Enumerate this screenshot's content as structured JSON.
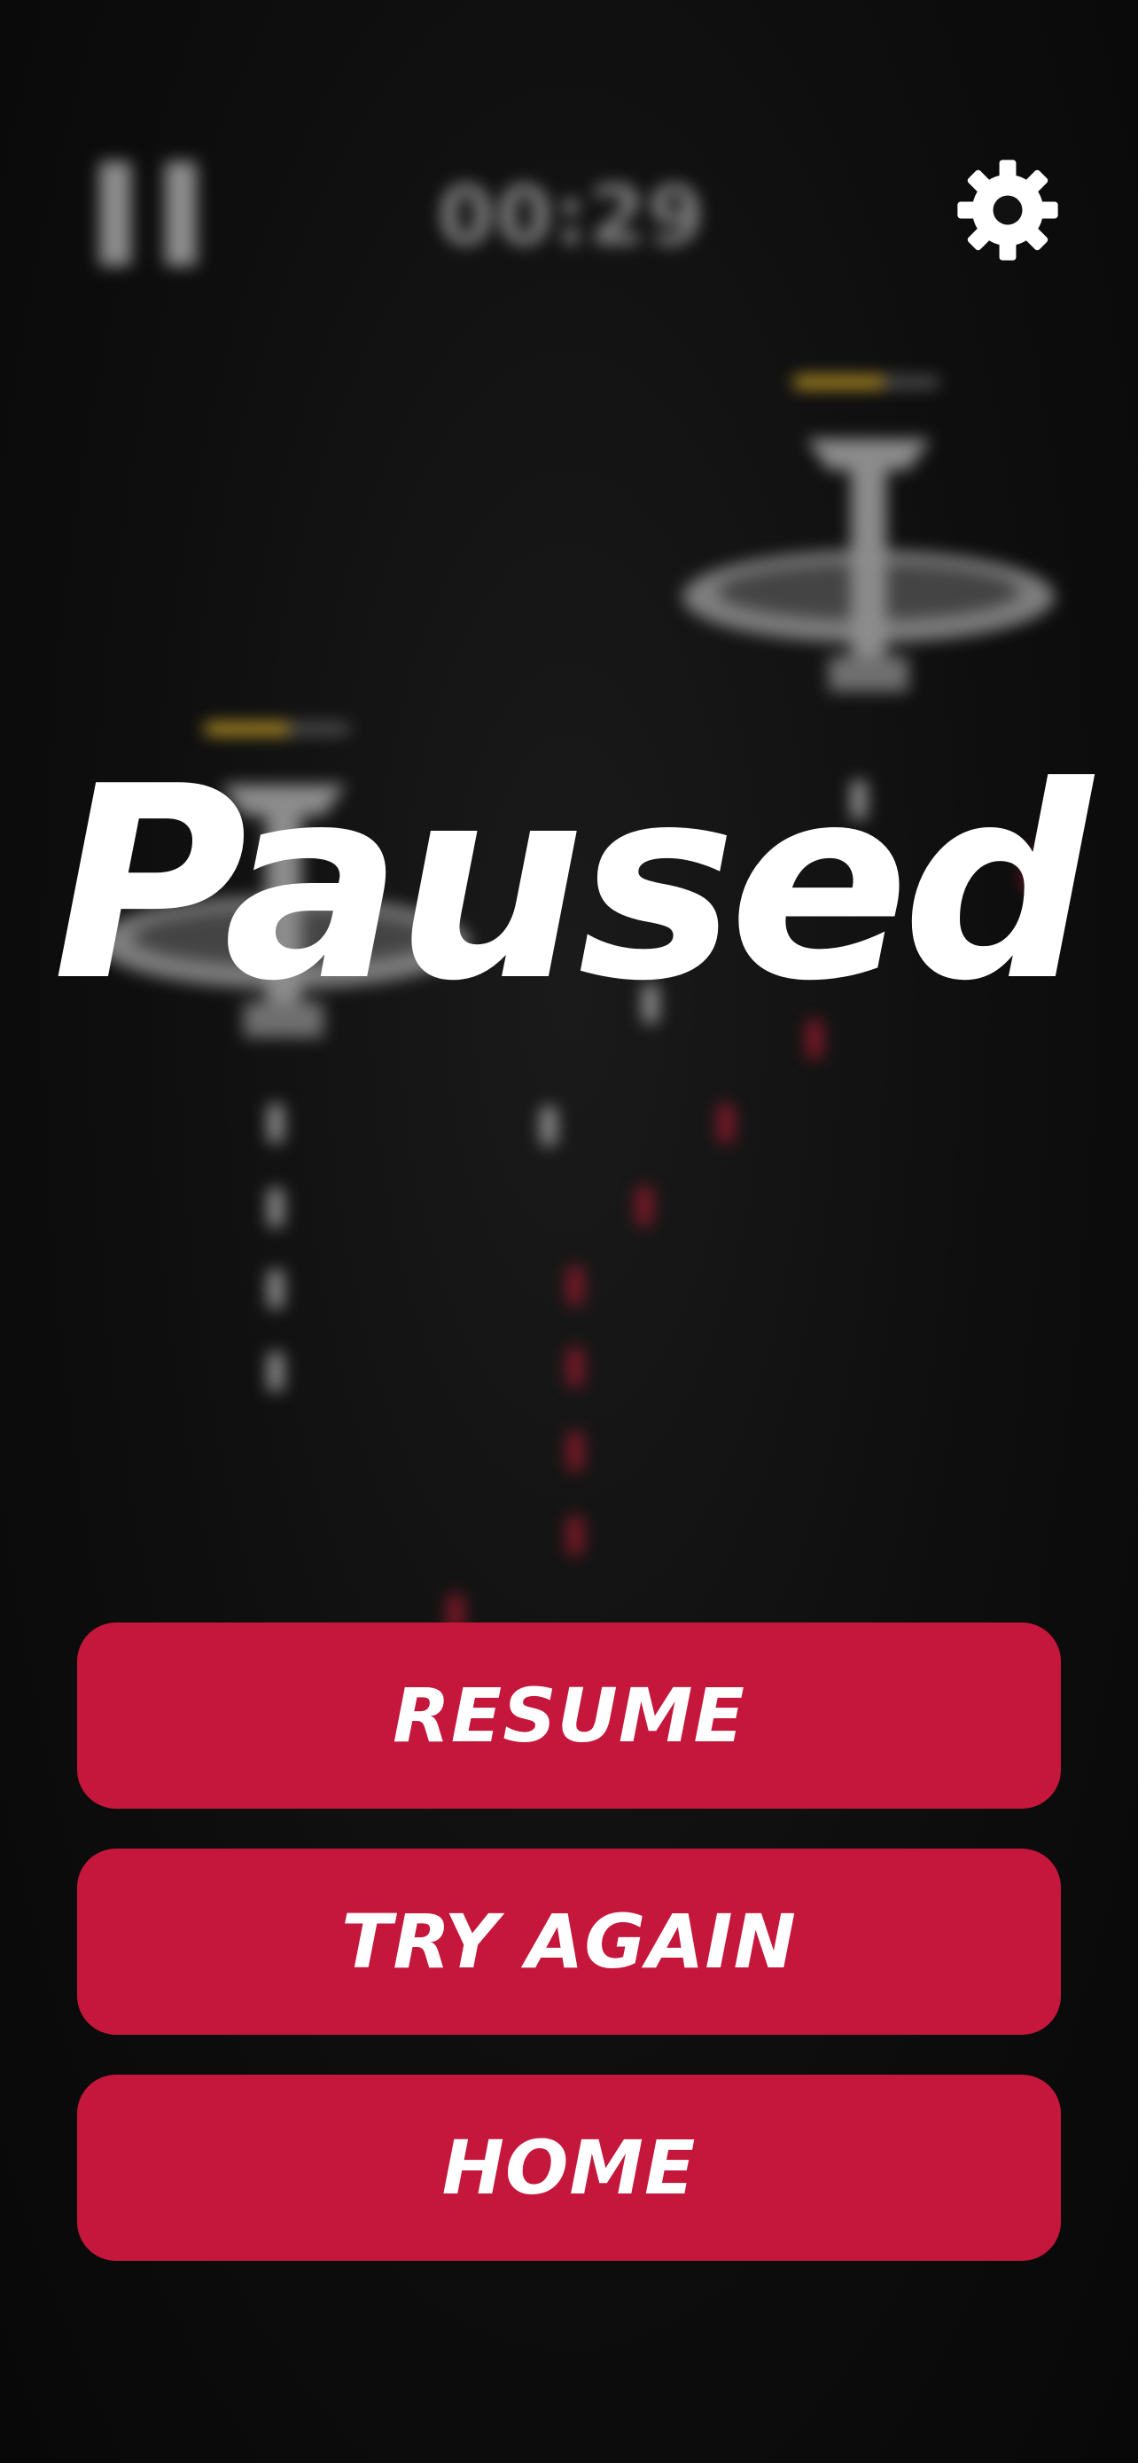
{
  "hud": {
    "timer": "00:29",
    "pause_icon": "pause-icon",
    "settings_icon": "gear-icon"
  },
  "overlay": {
    "title": "Paused"
  },
  "menu": {
    "resume_label": "RESUME",
    "try_again_label": "TRY AGAIN",
    "home_label": "HOME"
  },
  "colors": {
    "background": "#0b0b0b",
    "button": "#c5173b",
    "text": "#ffffff",
    "health": "#c9a227"
  }
}
